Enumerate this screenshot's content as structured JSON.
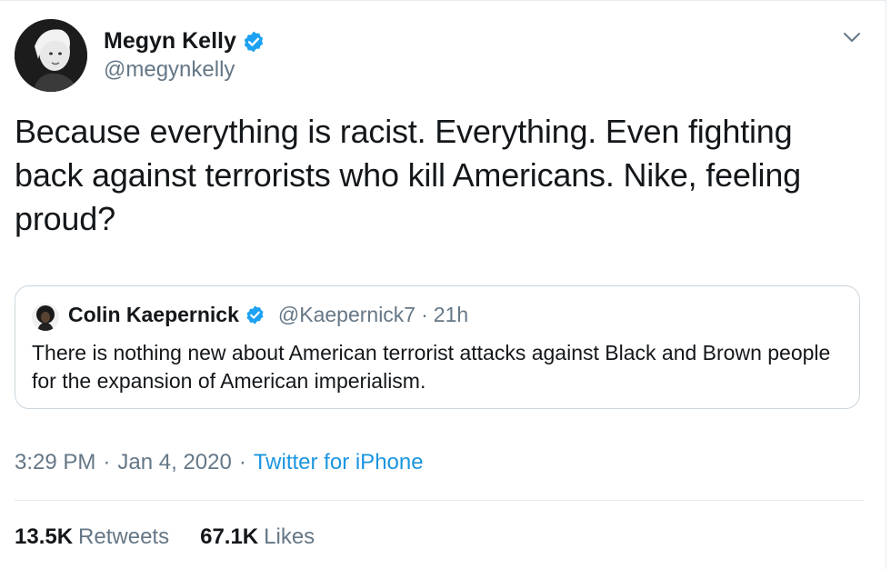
{
  "author": {
    "name": "Megyn Kelly",
    "handle": "@megynkelly"
  },
  "tweet": {
    "text": "Because everything is racist. Everything. Even fighting back against terrorists who kill Americans. Nike, feeling proud?"
  },
  "quoted_tweet": {
    "name": "Colin Kaepernick",
    "handle": "@Kaepernick7",
    "separator": "·",
    "time": "21h",
    "text": "There is nothing new about American terrorist attacks against Black and Brown people for the expansion of American imperialism."
  },
  "meta": {
    "time": "3:29 PM",
    "dot1": "·",
    "date": "Jan 4, 2020",
    "dot2": "·",
    "source": "Twitter for iPhone"
  },
  "stats": {
    "retweets_count": "13.5K",
    "retweets_label": "Retweets",
    "likes_count": "67.1K",
    "likes_label": "Likes"
  },
  "icons": {
    "verified": "verified-badge-icon",
    "caret": "chevron-down-icon"
  },
  "colors": {
    "accent": "#1da1f2",
    "link": "#1b95e0",
    "secondary_text": "#657786",
    "border": "#ccd6dd"
  }
}
